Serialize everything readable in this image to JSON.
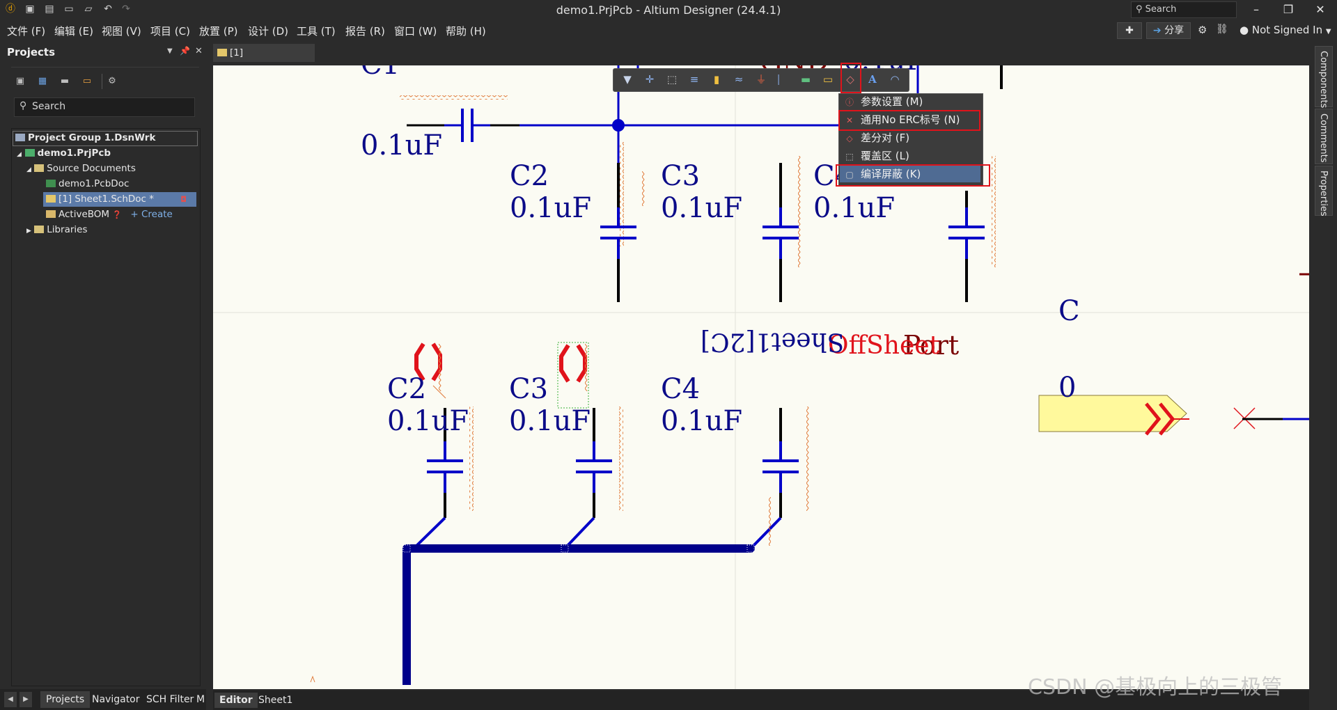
{
  "app": {
    "title": "demo1.PrjPcb - Altium Designer (24.4.1)",
    "search_placeholder": "Search"
  },
  "menu": [
    "文件 (F)",
    "编辑 (E)",
    "视图 (V)",
    "项目 (C)",
    "放置 (P)",
    "设计 (D)",
    "工具 (T)",
    "报告 (R)",
    "窗口 (W)",
    "帮助 (H)"
  ],
  "topright": {
    "share": "分享",
    "account": "Not Signed In"
  },
  "projects_panel": {
    "title": "Projects",
    "search": "Search",
    "tree": [
      {
        "label": "Project Group 1.DsnWrk"
      },
      {
        "label": "demo1.PrjPcb"
      },
      {
        "label": "Source Documents"
      },
      {
        "label": "demo1.PcbDoc"
      },
      {
        "label": "[1] Sheet1.SchDoc *"
      },
      {
        "label": "ActiveBOM",
        "extra": "+ Create"
      },
      {
        "label": "Libraries"
      }
    ],
    "tabs": [
      "Projects",
      "Navigator",
      "SCH Filter",
      "M"
    ]
  },
  "document_tab": "[1] Sheet1.SchDoc *",
  "editor_tabs": [
    "Editor",
    "Sheet1"
  ],
  "right_tabs": [
    "Components",
    "Comments",
    "Properties"
  ],
  "dropdown": {
    "items": [
      {
        "label": "参数设置 (M)",
        "icon": "param-icon"
      },
      {
        "label": "通用No ERC标号 (N)",
        "icon": "no-erc-icon",
        "highlighted": true
      },
      {
        "label": "差分对 (F)",
        "icon": "diff-pair-icon"
      },
      {
        "label": "覆盖区 (L)",
        "icon": "blanket-icon"
      },
      {
        "label": "编译屏蔽 (K)",
        "icon": "compile-mask-icon",
        "highlighted": true,
        "selected": true
      }
    ]
  },
  "schematic": {
    "top_components": [
      {
        "designator": "C1",
        "value": "0.1uF"
      },
      {
        "designator": "C2",
        "value": "0.1uF"
      },
      {
        "designator": "C3",
        "value": "0.1uF"
      },
      {
        "designator": "C4",
        "value": "0.1uF"
      }
    ],
    "bottom_components": [
      {
        "designator": "C2",
        "value": "0.1uF"
      },
      {
        "designator": "C3",
        "value": "0.1uF"
      },
      {
        "designator": "C4",
        "value": "0.1uF"
      }
    ],
    "gnd_label": "GND",
    "top_value_label": "0.1uF",
    "port_label": "Port",
    "offsheet_label": "OffSheet",
    "sheet_ref_label": "Sheet1[2C]",
    "edge_letters": [
      "C",
      "0"
    ]
  },
  "watermark": "CSDN @基极向上的三极管",
  "colors": {
    "wire": "#0000c8",
    "text_blue": "#0b0b88",
    "red": "#e0131b",
    "canvas": "#fbfbf3"
  }
}
